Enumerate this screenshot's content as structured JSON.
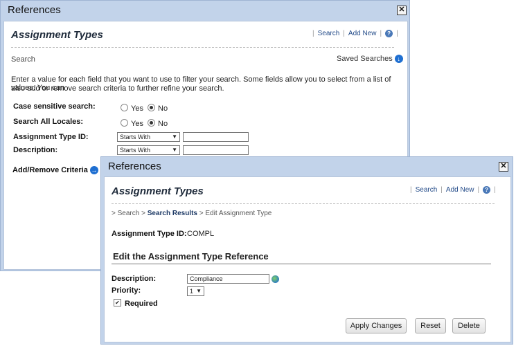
{
  "back_window": {
    "title": "References",
    "page_title": "Assignment Types",
    "links": {
      "search": "Search",
      "add_new": "Add New"
    },
    "breadcrumb": "Search",
    "saved_searches": "Saved Searches",
    "instructions_line1": "Enter a value for each field that you want to use to filter your search. Some fields allow you to select from a list of values. You can",
    "instructions_line2": "also add or remove search criteria to further refine your search.",
    "fields": {
      "case_sensitive": {
        "label": "Case sensitive search:",
        "yes": "Yes",
        "no": "No",
        "selected": "No"
      },
      "search_all_locales": {
        "label": "Search All Locales:",
        "yes": "Yes",
        "no": "No",
        "selected": "No"
      },
      "assignment_type_id": {
        "label": "Assignment Type ID:",
        "operator": "Starts With",
        "value": ""
      },
      "description": {
        "label": "Description:",
        "operator": "Starts With",
        "value": ""
      }
    },
    "add_remove_criteria": "Add/Remove Criteria"
  },
  "front_window": {
    "title": "References",
    "page_title": "Assignment Types",
    "links": {
      "search": "Search",
      "add_new": "Add New"
    },
    "breadcrumb": {
      "prefix": ">",
      "search": "Search",
      "sep1": ">",
      "search_results": "Search Results",
      "sep2": ">",
      "current": "Edit Assignment Type"
    },
    "assignment_type_id_label": "Assignment Type ID:",
    "assignment_type_id_value": "COMPL",
    "section_title": "Edit the Assignment Type Reference",
    "description_label": "Description:",
    "description_value": "Compliance",
    "priority_label": "Priority:",
    "priority_value": "1",
    "required_label": "Required",
    "required_checked": true,
    "buttons": {
      "apply": "Apply Changes",
      "reset": "Reset",
      "delete": "Delete"
    }
  },
  "icons": {
    "close": "close-icon",
    "help": "help-icon",
    "saved_searches": "arrow-down-circle-icon",
    "add_criteria": "arrow-right-circle-icon",
    "globe": "globe-icon"
  },
  "colors": {
    "window_frame": "#c2d3ea",
    "link": "#224a88",
    "accent_arrow": "#1f6fd1"
  }
}
